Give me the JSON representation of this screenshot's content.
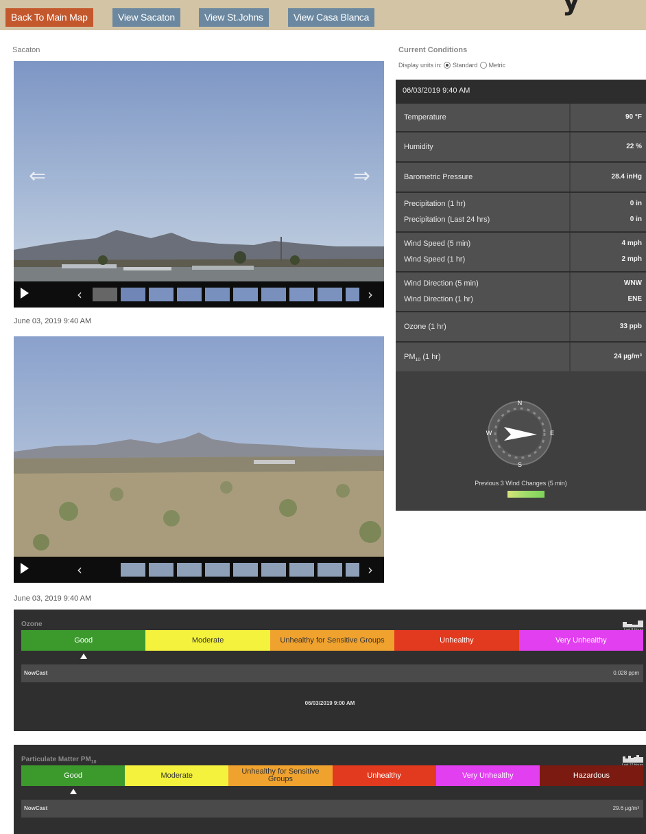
{
  "nav": {
    "back_label": "Back To Main Map",
    "sacaton_label": "View Sacaton",
    "stjohns_label": "View St.Johns",
    "casablanca_label": "View Casa Blanca"
  },
  "station": {
    "name": "Sacaton"
  },
  "cameras": [
    {
      "caption": "June 03, 2019 9:40 AM"
    },
    {
      "caption": "June 03, 2019 9:40 AM"
    }
  ],
  "current_conditions": {
    "title": "Current Conditions",
    "units_prefix": "Display units in:",
    "units_options": [
      "Standard",
      "Metric"
    ],
    "units_selected": "Standard",
    "timestamp": "06/03/2019 9:40 AM",
    "rows": [
      {
        "label": "Temperature",
        "value": "90 °F"
      },
      {
        "label": "Humidity",
        "value": "22 %"
      },
      {
        "label": "Barometric Pressure",
        "value": "28.4 inHg"
      },
      {
        "label": "Precipitation (1 hr)",
        "value": "0 in"
      },
      {
        "label": "Precipitation (Last 24 hrs)",
        "value": "0 in"
      },
      {
        "label": "Wind Speed (5 min)",
        "value": "4 mph"
      },
      {
        "label": "Wind Speed (1 hr)",
        "value": "2 mph"
      },
      {
        "label": "Wind Direction (5 min)",
        "value": "WNW"
      },
      {
        "label": "Wind Direction (1 hr)",
        "value": "ENE"
      },
      {
        "label": "Ozone (1 hr)",
        "value": "33 ppb"
      },
      {
        "label_main": "PM",
        "label_sub": "10",
        "label_rest": " (1 hr)",
        "value": "24 µg/m³"
      }
    ],
    "compass": {
      "n": "N",
      "s": "S",
      "e": "E",
      "w": "W"
    },
    "wind_changes_caption": "Previous 3 Wind Changes (5 min)"
  },
  "ozone": {
    "title": "Ozone",
    "history_label": "Last 8 Hours",
    "categories": [
      "Good",
      "Moderate",
      "Unhealthy for Sensitive Groups",
      "Unhealthy",
      "Very Unhealthy"
    ],
    "category_colors": [
      "#3c9a2d",
      "#f4f23c",
      "#f0a22e",
      "#e23a1f",
      "#e23ff0"
    ],
    "category_text_colors": [
      "#ffffff",
      "#333333",
      "#333333",
      "#ffffff",
      "#ffffff"
    ],
    "marker_category_index": 0,
    "nowcast_label": "NowCast",
    "nowcast_value": "0.028 ppm",
    "timestamp": "06/03/2019 9:00 AM"
  },
  "pm10": {
    "title_main": "Particulate Matter PM",
    "title_sub": "10",
    "history_label": "Last 12 Hours",
    "categories": [
      "Good",
      "Moderate",
      "Unhealthy for Sensitive Groups",
      "Unhealthy",
      "Very Unhealthy",
      "Hazardous"
    ],
    "category_colors": [
      "#3c9a2d",
      "#f4f23c",
      "#f0a22e",
      "#e23a1f",
      "#e23ff0",
      "#7a1a10"
    ],
    "category_text_colors": [
      "#ffffff",
      "#333333",
      "#333333",
      "#ffffff",
      "#ffffff",
      "#ffffff"
    ],
    "marker_category_index": 0,
    "nowcast_label": "NowCast",
    "nowcast_value": "29.6 µg/m³"
  }
}
